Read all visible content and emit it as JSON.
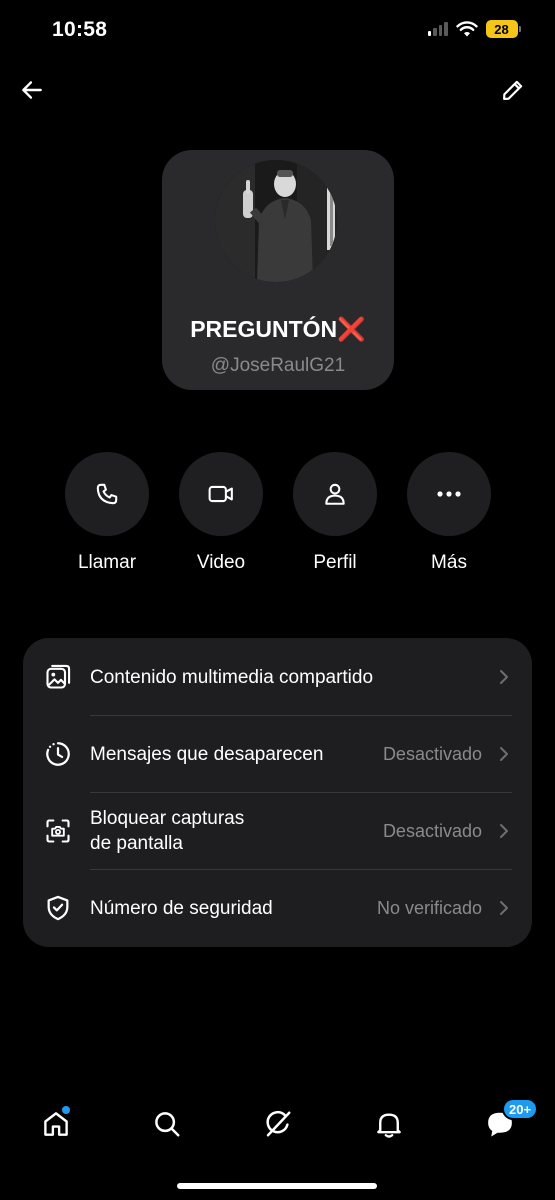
{
  "status_bar": {
    "time": "10:58",
    "battery": "28",
    "battery_color": "#f5c518"
  },
  "top_nav": {
    "back_icon": "arrow-left-icon",
    "edit_icon": "pencil-icon"
  },
  "profile": {
    "display_name": "PREGUNTÓN",
    "name_emoji": "❌",
    "handle": "@JoseRaulG21"
  },
  "actions": [
    {
      "label": "Llamar",
      "icon": "phone-icon"
    },
    {
      "label": "Video",
      "icon": "video-camera-icon"
    },
    {
      "label": "Perfil",
      "icon": "person-icon"
    },
    {
      "label": "Más",
      "icon": "more-dots-icon"
    }
  ],
  "settings": [
    {
      "label": "Contenido multimedia compartido",
      "value": "",
      "icon": "media-gallery-icon"
    },
    {
      "label": "Mensajes que desaparecen",
      "value": "Desactivado",
      "icon": "timer-clock-icon"
    },
    {
      "label_line1": "Bloquear capturas",
      "label_line2": "de pantalla",
      "value": "Desactivado",
      "icon": "screenshot-camera-icon"
    },
    {
      "label": "Número de seguridad",
      "value": "No verificado",
      "icon": "shield-check-icon"
    }
  ],
  "bottom_nav": {
    "items": [
      "home-icon",
      "search-icon",
      "grok-icon",
      "bell-icon",
      "messages-icon"
    ],
    "messages_badge": "20+",
    "accent_color": "#1d9bf0"
  }
}
